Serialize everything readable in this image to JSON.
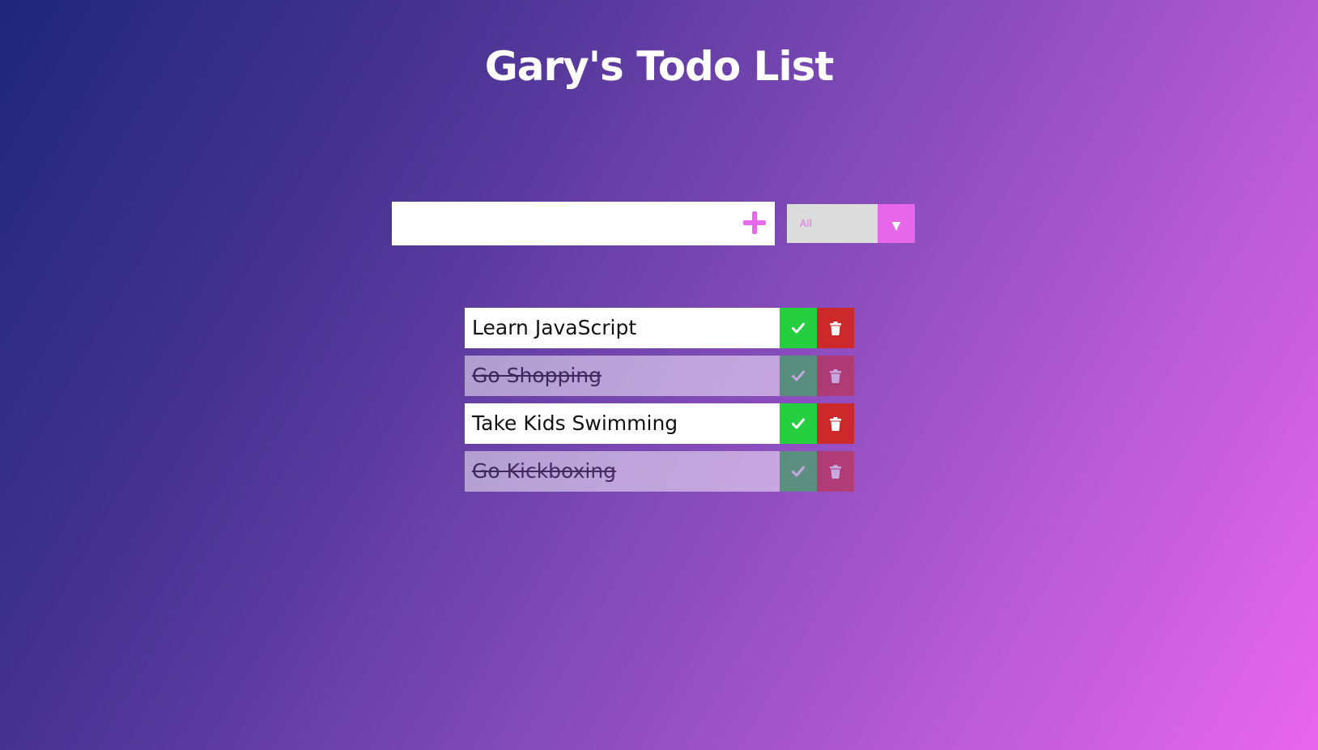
{
  "header": {
    "title": "Gary's Todo List"
  },
  "form": {
    "input_value": "",
    "input_placeholder": "",
    "add_icon": "plus-icon",
    "filter_selected": "All",
    "filter_arrow": "▼"
  },
  "todos": [
    {
      "text": "Learn JavaScript",
      "completed": false
    },
    {
      "text": "Go Shopping",
      "completed": true
    },
    {
      "text": "Take Kids Swimming",
      "completed": false
    },
    {
      "text": "Go Kickboxing",
      "completed": true
    }
  ],
  "colors": {
    "accent": "#e868ec",
    "complete": "#26cf40",
    "delete": "#cc2a2a"
  }
}
